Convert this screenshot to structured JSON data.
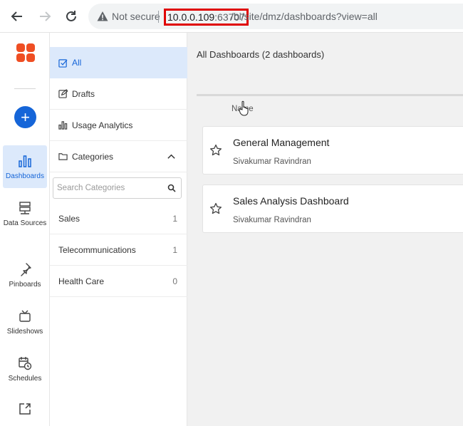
{
  "browser": {
    "security_label": "Not secure",
    "url_host": "10.0.0.109",
    "url_port": ":63707",
    "url_path": "/bi/site/dmz/dashboards?view=all"
  },
  "rail": {
    "add_label": "+",
    "items": [
      {
        "label": "Dashboards",
        "icon": "bar-chart-icon",
        "active": true
      },
      {
        "label": "Data Sources",
        "icon": "server-icon"
      },
      {
        "label": "Pinboards",
        "icon": "pin-icon"
      },
      {
        "label": "Slideshows",
        "icon": "tv-icon"
      },
      {
        "label": "Schedules",
        "icon": "calendar-clock-icon"
      },
      {
        "label": "",
        "icon": "export-icon"
      }
    ]
  },
  "sidebar": {
    "all_label": "All",
    "drafts_label": "Drafts",
    "usage_label": "Usage Analytics",
    "categories_label": "Categories",
    "search_placeholder": "Search Categories",
    "categories": [
      {
        "name": "Sales",
        "count": "1"
      },
      {
        "name": "Telecommunications",
        "count": "1"
      },
      {
        "name": "Health Care",
        "count": "0"
      }
    ]
  },
  "main": {
    "title": "All Dashboards (2 dashboards)",
    "column_name": "Name",
    "dashboards": [
      {
        "title": "General Management",
        "owner": "Sivakumar Ravindran"
      },
      {
        "title": "Sales Analysis Dashboard",
        "owner": "Sivakumar Ravindran"
      }
    ]
  },
  "colors": {
    "accent": "#1565d8",
    "active_bg": "#dce9fb",
    "logo": "#ef4e23",
    "highlight_box": "#e00000"
  }
}
